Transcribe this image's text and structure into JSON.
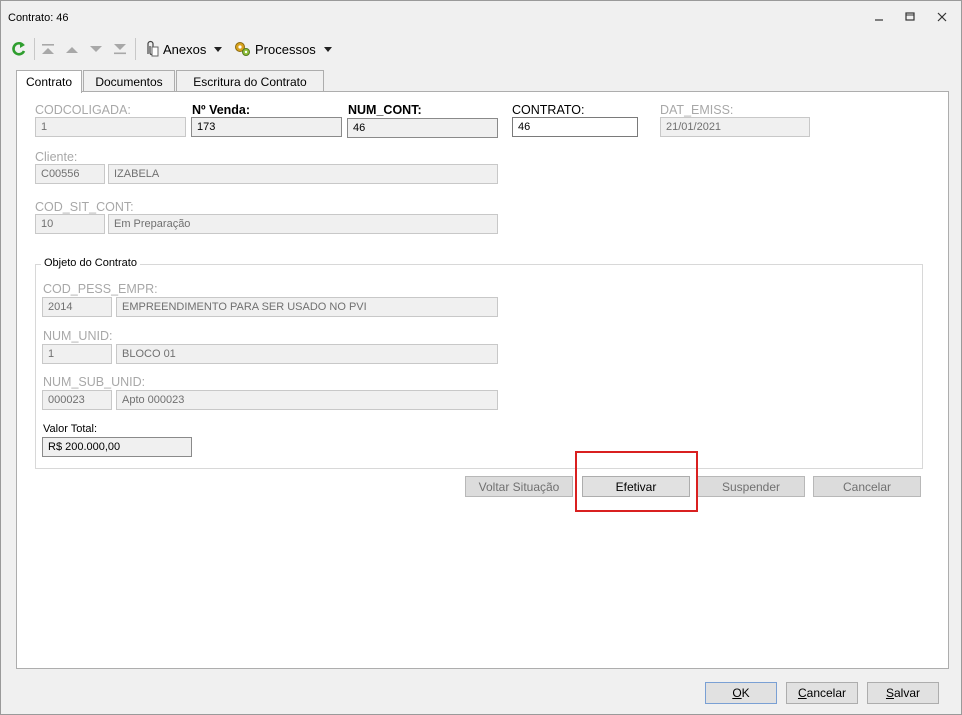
{
  "window": {
    "title": "Contrato: 46"
  },
  "toolbar": {
    "anexos": "Anexos",
    "processos": "Processos"
  },
  "tabs": [
    "Contrato",
    "Documentos",
    "Escritura do Contrato"
  ],
  "form": {
    "codcoligada": {
      "label": "CODCOLIGADA:",
      "value": "1"
    },
    "nvenda": {
      "label": "Nº Venda:",
      "value": "173"
    },
    "num_cont": {
      "label": "NUM_CONT:",
      "value": "46"
    },
    "contrato": {
      "label": "CONTRATO:",
      "value": "46"
    },
    "dat_emiss": {
      "label": "DAT_EMISS:",
      "value": "21/01/2021"
    },
    "cliente": {
      "label": "Cliente:",
      "code": "C00556",
      "name": "IZABELA"
    },
    "cod_sit_cont": {
      "label": "COD_SIT_CONT:",
      "code": "10",
      "name": "Em Preparação"
    }
  },
  "objeto": {
    "title": "Objeto do Contrato",
    "cod_pess_empr": {
      "label": "COD_PESS_EMPR:",
      "code": "2014",
      "name": "EMPREENDIMENTO PARA SER USADO NO PVI"
    },
    "num_unid": {
      "label": "NUM_UNID:",
      "code": "1",
      "name": "BLOCO 01"
    },
    "num_sub_unid": {
      "label": "NUM_SUB_UNID:",
      "code": "000023",
      "name": "Apto 000023"
    },
    "valor_total": {
      "label": "Valor Total:",
      "value": "R$ 200.000,00"
    }
  },
  "actions": {
    "voltar": "Voltar Situação",
    "efetivar": "Efetivar",
    "suspender": "Suspender",
    "cancelar": "Cancelar"
  },
  "footer": {
    "ok_u": "O",
    "ok_rest": "K",
    "cancelar_u": "C",
    "cancelar_rest": "ancelar",
    "salvar_u": "S",
    "salvar_rest": "alvar"
  },
  "colors": {
    "highlight": "#d92020",
    "refresh": "#2f9e2f"
  },
  "icons": [
    "refresh-icon",
    "first-record-icon",
    "previous-record-icon",
    "next-record-icon",
    "last-record-icon",
    "paperclip-icon",
    "gears-icon",
    "minimize-icon",
    "restore-icon",
    "close-icon"
  ]
}
